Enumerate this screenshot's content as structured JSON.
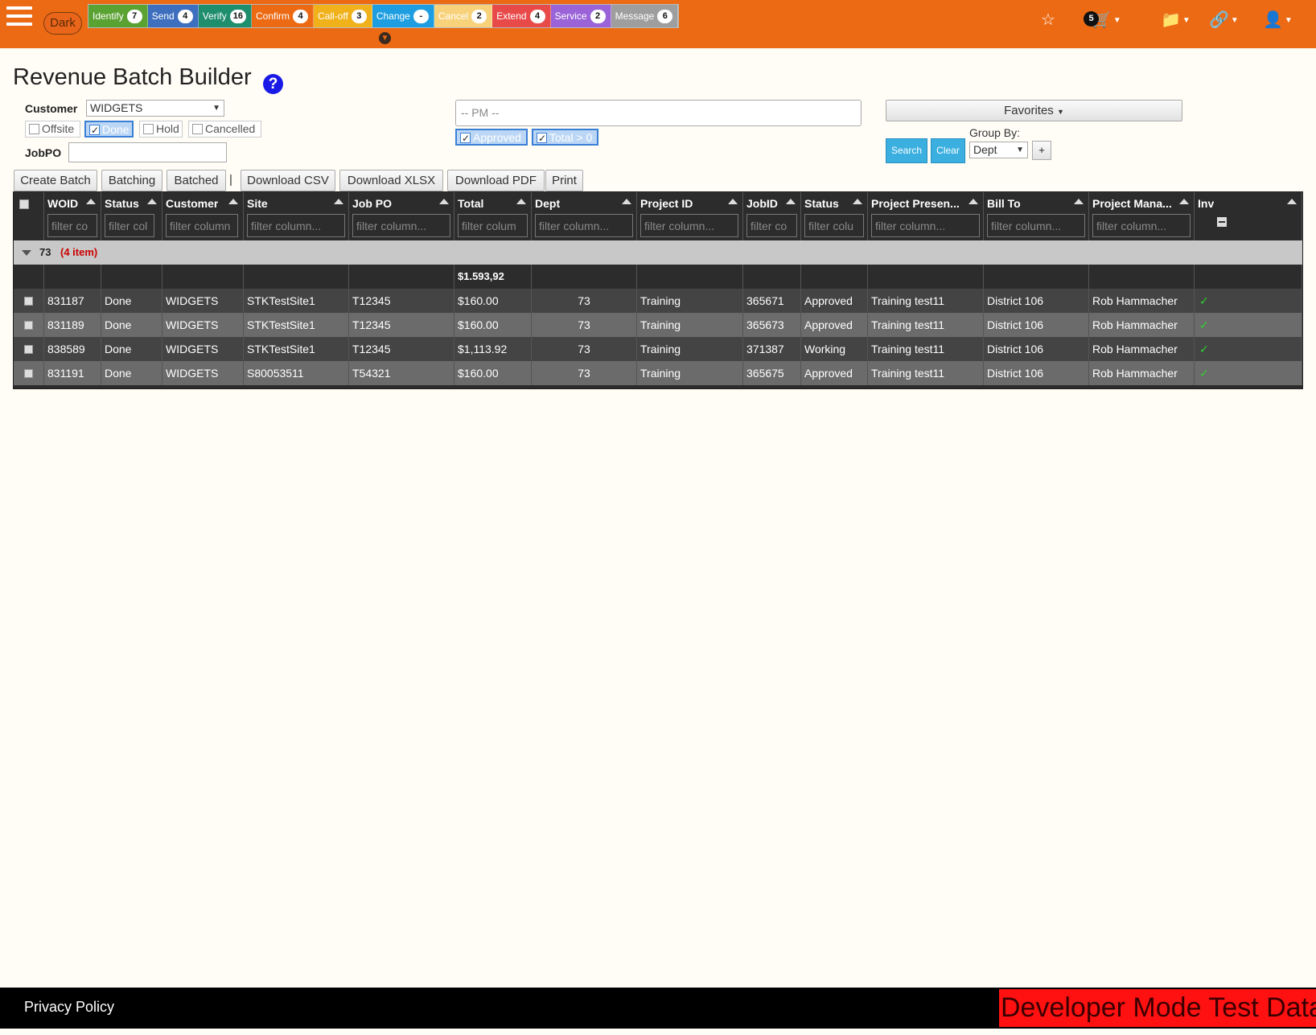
{
  "header": {
    "dark_toggle": "Dark",
    "status_buttons": [
      {
        "label": "Identify",
        "count": "7",
        "color": "#5aa232"
      },
      {
        "label": "Send",
        "count": "4",
        "color": "#3d6fbe"
      },
      {
        "label": "Verify",
        "count": "16",
        "color": "#1f8e6c"
      },
      {
        "label": "Confirm",
        "count": "4",
        "color": "#ec6a13"
      },
      {
        "label": "Call-off",
        "count": "3",
        "color": "#f0b11b"
      },
      {
        "label": "Change",
        "count": "-",
        "color": "#1e9ee0"
      },
      {
        "label": "Cancel",
        "count": "2",
        "color": "#f7d27a"
      },
      {
        "label": "Extend",
        "count": "4",
        "color": "#e84a4a"
      },
      {
        "label": "Service",
        "count": "2",
        "color": "#9a64d8"
      },
      {
        "label": "Message",
        "count": "6",
        "color": "#9e9e9e"
      }
    ],
    "cart_count": "5",
    "icons": [
      "star-icon",
      "cart-icon",
      "folder-icon",
      "link-icon",
      "user-icon"
    ]
  },
  "page": {
    "title": "Revenue Batch Builder",
    "help": "?"
  },
  "filters": {
    "customer_label": "Customer",
    "customer_value": "WIDGETS",
    "checkboxes": [
      {
        "label": "Offsite",
        "checked": false
      },
      {
        "label": "Done",
        "checked": true
      },
      {
        "label": "Hold",
        "checked": false
      },
      {
        "label": "Cancelled",
        "checked": false
      }
    ],
    "jobpo_label": "JobPO",
    "jobpo_value": "",
    "pm_placeholder": "-- PM --",
    "approved_label": "Approved",
    "total_label": "Total > 0",
    "favorites_label": "Favorites",
    "search_label": "Search",
    "clear_label": "Clear",
    "groupby_label": "Group By:",
    "groupby_value": "Dept",
    "plus_label": "+"
  },
  "actions": {
    "create_batch": "Create Batch",
    "batching": "Batching",
    "batched": "Batched",
    "pipe": "|",
    "download_csv": "Download CSV",
    "download_xlsx": "Download XLSX",
    "download_pdf": "Download PDF",
    "print": "Print"
  },
  "grid": {
    "columns": [
      {
        "label": "",
        "filter": ""
      },
      {
        "label": "WOID",
        "filter": "filter co"
      },
      {
        "label": "Status",
        "filter": "filter col"
      },
      {
        "label": "Customer",
        "filter": "filter column"
      },
      {
        "label": "Site",
        "filter": "filter column..."
      },
      {
        "label": "Job PO",
        "filter": "filter column..."
      },
      {
        "label": "Total",
        "filter": "filter colum"
      },
      {
        "label": "Dept",
        "filter": "filter column..."
      },
      {
        "label": "Project ID",
        "filter": "filter column..."
      },
      {
        "label": "JobID",
        "filter": "filter co"
      },
      {
        "label": "Status",
        "filter": "filter colu"
      },
      {
        "label": "Project Presen...",
        "filter": "filter column..."
      },
      {
        "label": "Bill To",
        "filter": "filter column..."
      },
      {
        "label": "Project Mana...",
        "filter": "filter column..."
      },
      {
        "label": "Inv",
        "filter": ""
      }
    ],
    "group": {
      "value": "73",
      "count_text": "(4 item)"
    },
    "sum_total": "$1.593,92",
    "rows": [
      [
        "831187",
        "Done",
        "WIDGETS",
        "STKTestSite1",
        "T12345",
        "$160.00",
        "73",
        "Training",
        "365671",
        "Approved",
        "Training test11",
        "District 106",
        "Rob Hammacher",
        "✓"
      ],
      [
        "831189",
        "Done",
        "WIDGETS",
        "STKTestSite1",
        "T12345",
        "$160.00",
        "73",
        "Training",
        "365673",
        "Approved",
        "Training test11",
        "District 106",
        "Rob Hammacher",
        "✓"
      ],
      [
        "838589",
        "Done",
        "WIDGETS",
        "STKTestSite1",
        "T12345",
        "$1,113.92",
        "73",
        "Training",
        "371387",
        "Working",
        "Training test11",
        "District 106",
        "Rob Hammacher",
        "✓"
      ],
      [
        "831191",
        "Done",
        "WIDGETS",
        "S80053511",
        "T54321",
        "$160.00",
        "73",
        "Training",
        "365675",
        "Approved",
        "Training test11",
        "District 106",
        "Rob Hammacher",
        "✓"
      ]
    ]
  },
  "footer": {
    "privacy": "Privacy Policy",
    "devmode": "Developer Mode Test Data"
  }
}
